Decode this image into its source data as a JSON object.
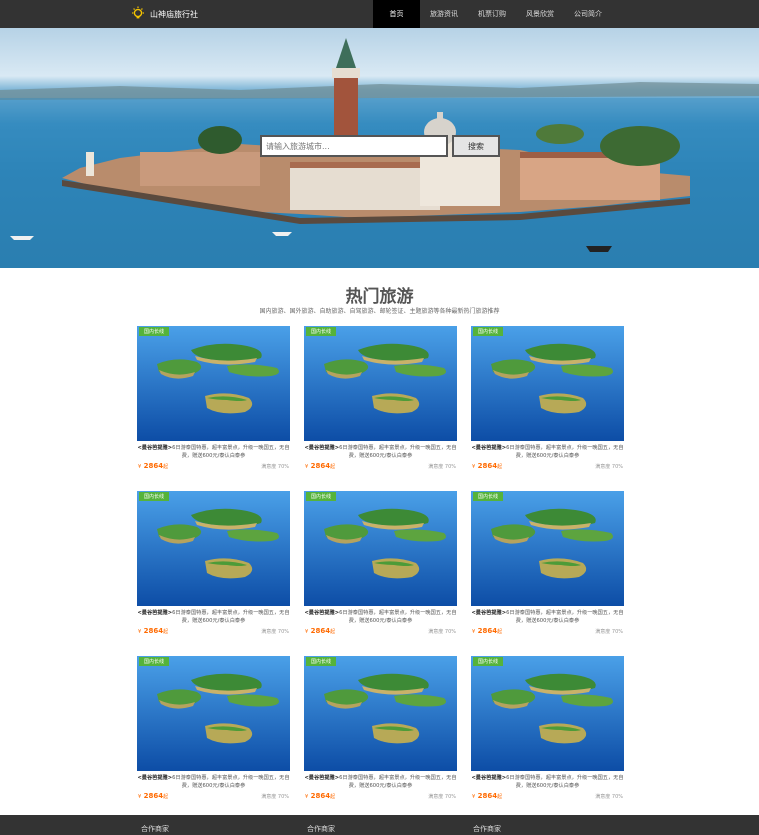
{
  "header": {
    "brand": "山神庙旅行社",
    "nav": [
      {
        "label": "首页",
        "active": true
      },
      {
        "label": "旅游资讯",
        "active": false
      },
      {
        "label": "机票订购",
        "active": false
      },
      {
        "label": "风景欣赏",
        "active": false
      },
      {
        "label": "公司简介",
        "active": false
      }
    ]
  },
  "search": {
    "placeholder": "请输入旅游城市...",
    "button_label": "搜索"
  },
  "section": {
    "title": "热门旅游",
    "subtitle": "国内旅游、国外旅游、自助旅游、自驾旅游、邮轮签证、主题旅游等各种最新热门旅游推荐"
  },
  "tours": [
    {
      "tag": "国内长线",
      "name": "<曼谷芭提雅>",
      "desc": "6日游泰国特惠，超丰富景点，升级一晚国五，无自费，赠送600元/泰认白泰参",
      "currency": "¥",
      "price": "2864",
      "unit": "起",
      "satisfaction": "满意度 70%"
    },
    {
      "tag": "国内长线",
      "name": "<曼谷芭提雅>",
      "desc": "6日游泰国特惠，超丰富景点，升级一晚国五，无自费，赠送600元/泰认白泰参",
      "currency": "¥",
      "price": "2864",
      "unit": "起",
      "satisfaction": "满意度 70%"
    },
    {
      "tag": "国内长线",
      "name": "<曼谷芭提雅>",
      "desc": "6日游泰国特惠，超丰富景点，升级一晚国五，无自费，赠送600元/泰认白泰参",
      "currency": "¥",
      "price": "2864",
      "unit": "起",
      "satisfaction": "满意度 70%"
    },
    {
      "tag": "国内长线",
      "name": "<曼谷芭提雅>",
      "desc": "6日游泰国特惠，超丰富景点，升级一晚国五，无自费，赠送600元/泰认白泰参",
      "currency": "¥",
      "price": "2864",
      "unit": "起",
      "satisfaction": "满意度 70%"
    },
    {
      "tag": "国内长线",
      "name": "<曼谷芭提雅>",
      "desc": "6日游泰国特惠，超丰富景点，升级一晚国五，无自费，赠送600元/泰认白泰参",
      "currency": "¥",
      "price": "2864",
      "unit": "起",
      "satisfaction": "满意度 70%"
    },
    {
      "tag": "国内长线",
      "name": "<曼谷芭提雅>",
      "desc": "6日游泰国特惠，超丰富景点，升级一晚国五，无自费，赠送600元/泰认白泰参",
      "currency": "¥",
      "price": "2864",
      "unit": "起",
      "satisfaction": "满意度 70%"
    },
    {
      "tag": "国内长线",
      "name": "<曼谷芭提雅>",
      "desc": "6日游泰国特惠，超丰富景点，升级一晚国五，无自费，赠送600元/泰认白泰参",
      "currency": "¥",
      "price": "2864",
      "unit": "起",
      "satisfaction": "满意度 70%"
    },
    {
      "tag": "国内长线",
      "name": "<曼谷芭提雅>",
      "desc": "6日游泰国特惠，超丰富景点，升级一晚国五，无自费，赠送600元/泰认白泰参",
      "currency": "¥",
      "price": "2864",
      "unit": "起",
      "satisfaction": "满意度 70%"
    },
    {
      "tag": "国内长线",
      "name": "<曼谷芭提雅>",
      "desc": "6日游泰国特惠，超丰富景点，升级一晚国五，无自费，赠送600元/泰认白泰参",
      "currency": "¥",
      "price": "2864",
      "unit": "起",
      "satisfaction": "满意度 70%"
    }
  ],
  "footer": {
    "columns": [
      "合作商家",
      "合作商家",
      "合作商家"
    ]
  },
  "colors": {
    "header_bg": "#333333",
    "tag_green": "#55b33b",
    "price_orange": "#ff6a00"
  }
}
